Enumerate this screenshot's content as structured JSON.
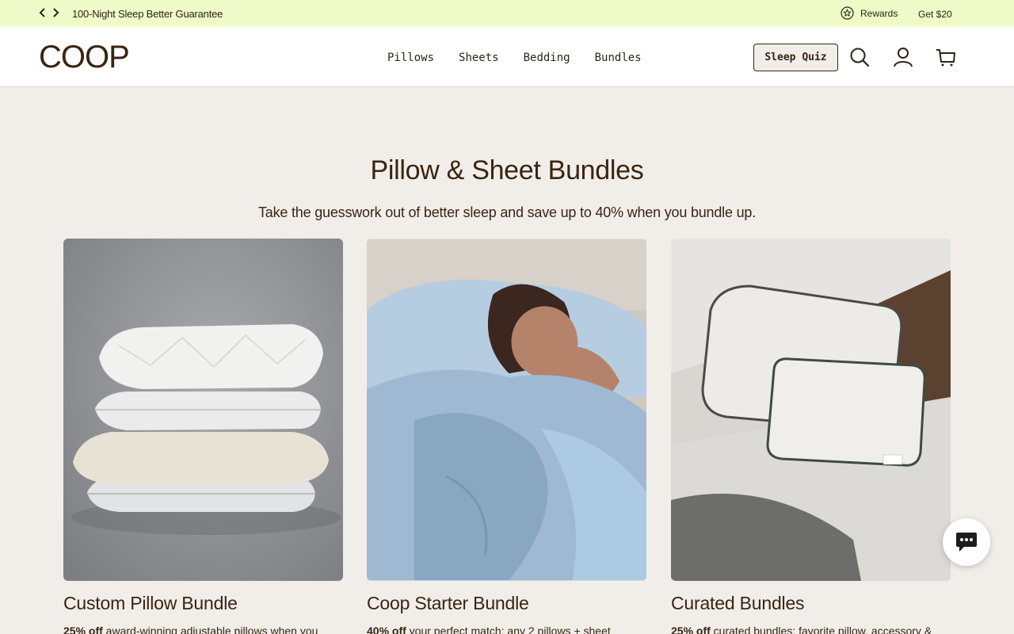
{
  "announcement": {
    "prev_icon": "chevron-left-icon",
    "next_icon": "chevron-right-icon",
    "message": "100-Night Sleep Better Guarantee",
    "rewards_label": "Rewards",
    "rewards_icon": "star-badge-icon",
    "get_label": "Get $20"
  },
  "header": {
    "logo": "COOP",
    "nav": [
      "Pillows",
      "Sheets",
      "Bedding",
      "Bundles"
    ],
    "quiz_label": "Sleep Quiz",
    "icons": [
      "search-icon",
      "account-icon",
      "cart-icon"
    ]
  },
  "main": {
    "heading": "Pillow & Sheet Bundles",
    "subheading": "Take the guesswork out of better sleep and save up to 40% when you bundle up.",
    "cards": [
      {
        "title": "Custom Pillow Bundle",
        "discount": "25% off",
        "desc": " award-winning adjustable pillows when you"
      },
      {
        "title": "Coop Starter Bundle",
        "discount": "40% off",
        "desc": " your perfect match: any 2 pillows + sheet"
      },
      {
        "title": "Curated Bundles",
        "discount": "25% off",
        "desc": " curated bundles: favorite pillow, accessory &"
      }
    ]
  },
  "chat": {
    "icon": "chat-bubble-icon"
  },
  "colors": {
    "announcement_bg": "#eefbc8",
    "page_bg": "#f1eeea",
    "brand_brown": "#3a2410"
  }
}
